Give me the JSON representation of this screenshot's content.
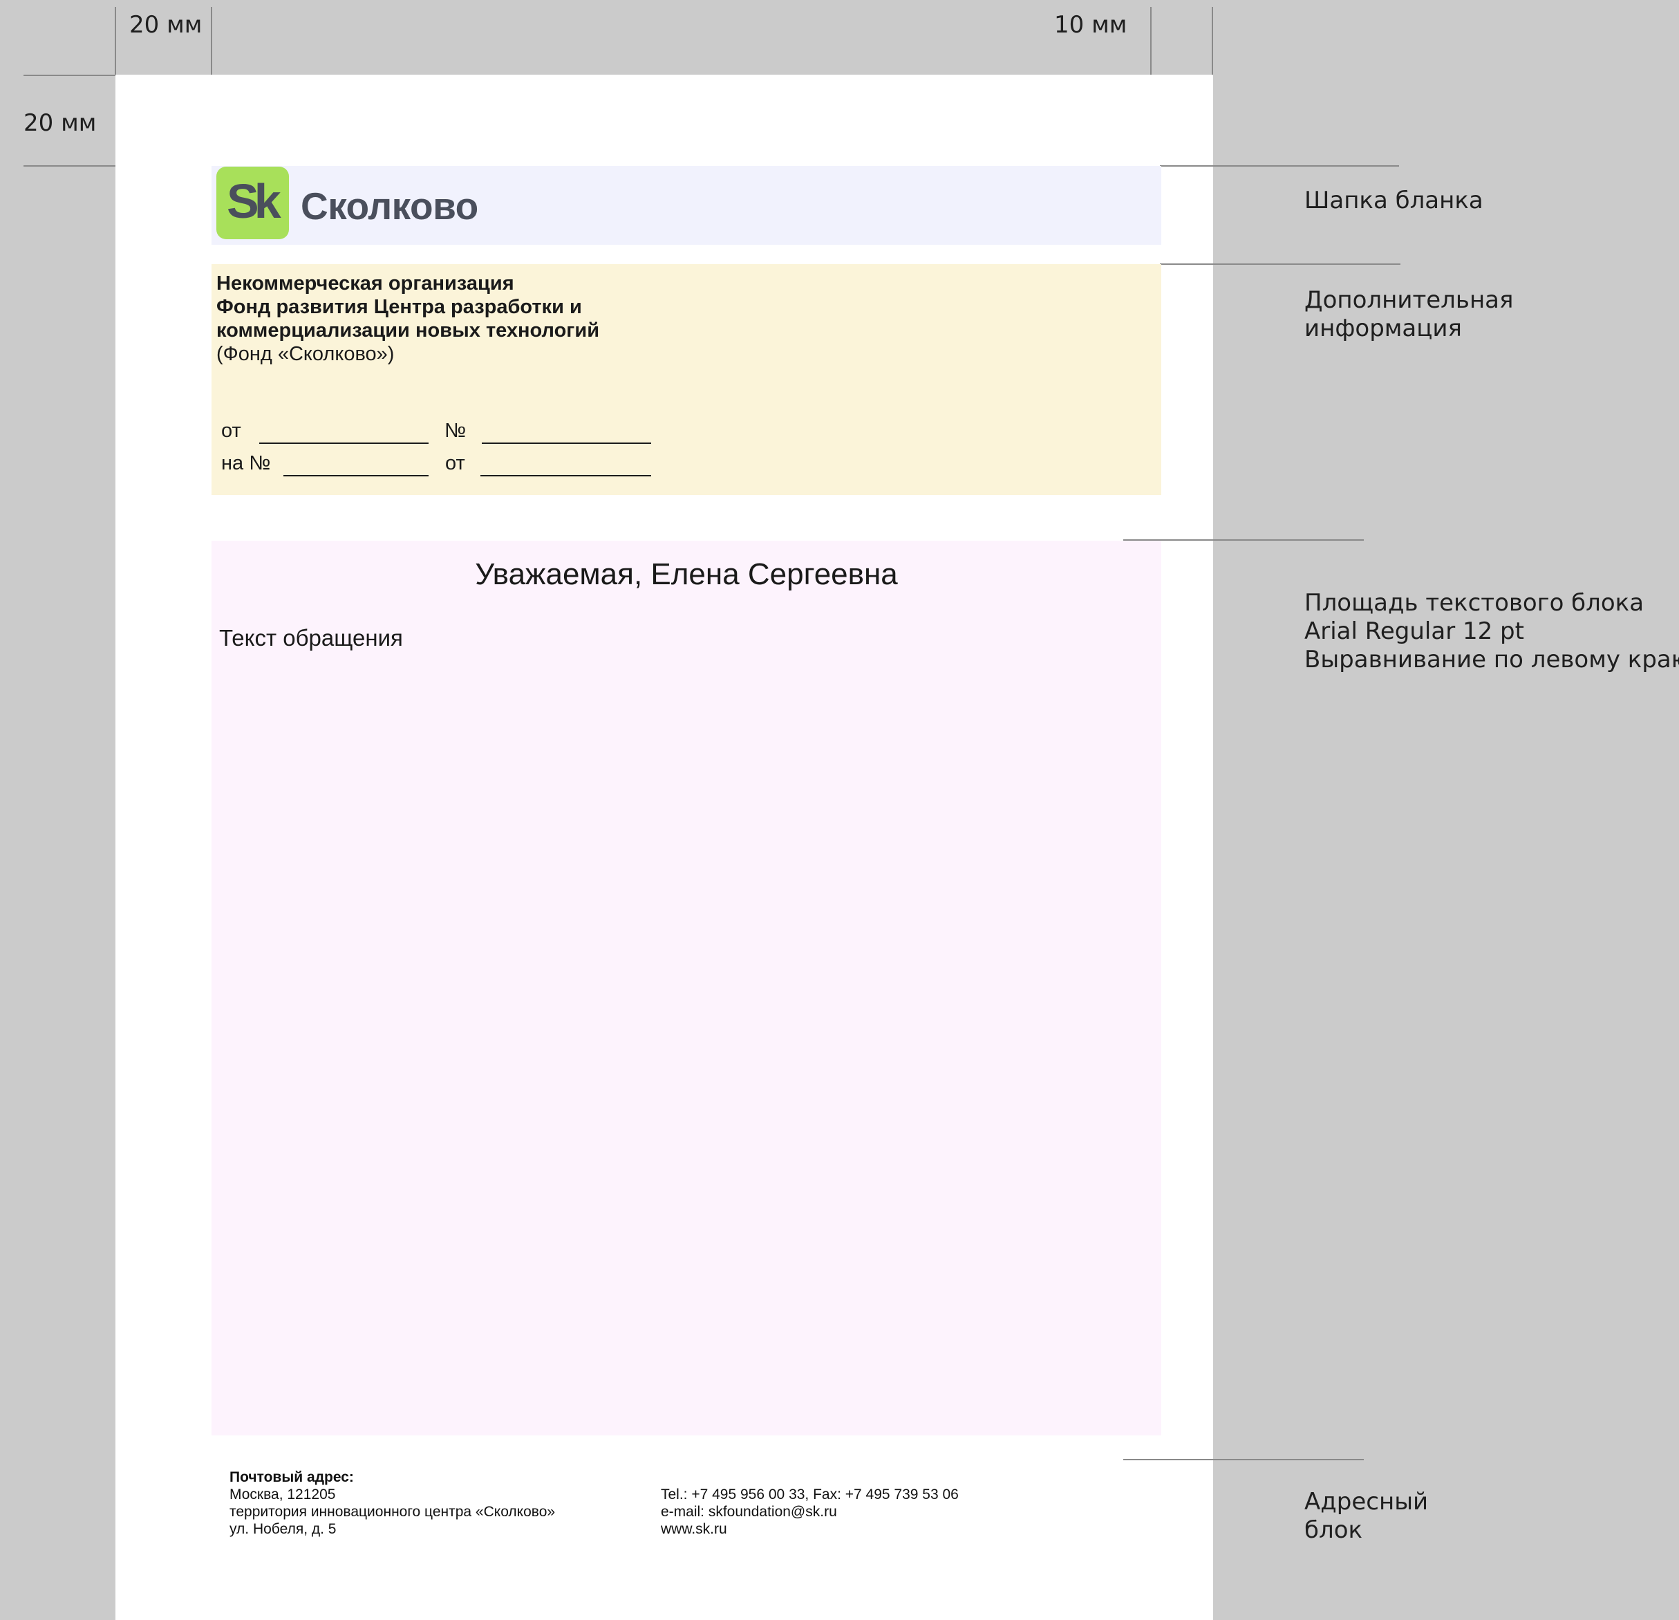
{
  "measurements": {
    "left_margin": "20 мм",
    "right_margin": "10 мм",
    "top_margin": "20 мм"
  },
  "annotations": {
    "header": "Шапка бланка",
    "extra_info": [
      "Дополнительная",
      "информация"
    ],
    "text_area": [
      "Площадь текстового блока",
      "Arial Regular 12 pt",
      "Выравнивание по левому краю"
    ],
    "address_block": [
      "Адресный",
      "блок"
    ]
  },
  "header": {
    "logo_mark": "Sk",
    "logo_word": "Сколково",
    "background": "#f1f2fd",
    "logo_color": "#a8e05a"
  },
  "info": {
    "org_lines_bold": [
      "Некоммерческая организация",
      "Фонд развития Центра разработки и",
      "коммерциализации новых технологий"
    ],
    "org_short": "(Фонд «Сколково»)",
    "row1": {
      "from_label": "от",
      "number_label": "№"
    },
    "row2": {
      "ref_number_label": "на №",
      "from_label": "от"
    },
    "background": "#fbf4d9"
  },
  "body": {
    "greeting": "Уважаемая, Елена Сергеевна",
    "appeal_text": "Текст обращения",
    "background": "#fdf3fd"
  },
  "address": {
    "title": "Почтовый адрес:",
    "city": "Москва, 121205",
    "territory": "территория инновационного центра «Сколково»",
    "street": "ул. Нобеля, д. 5",
    "phone": "Tel.: +7 495 956 00 33, Fax: +7 495 739 53 06",
    "email": "e-mail: skfoundation@sk.ru",
    "web": "www.sk.ru"
  }
}
